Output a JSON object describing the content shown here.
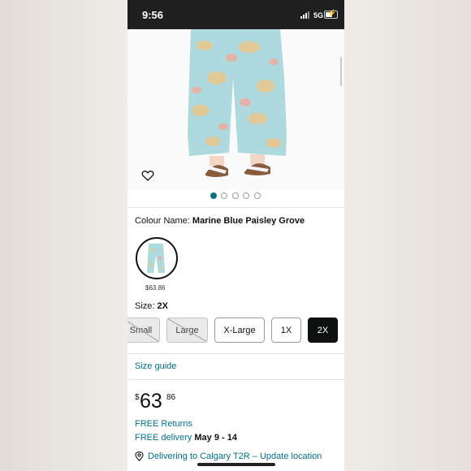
{
  "status_bar": {
    "time": "9:56",
    "network": "5G"
  },
  "colour": {
    "label": "Colour Name:",
    "value": "Marine Blue Paisley Grove",
    "swatch_price": "$63.86"
  },
  "size": {
    "label": "Size:",
    "value": "2X",
    "options": [
      {
        "label": "Small",
        "state": "unavailable"
      },
      {
        "label": "Large",
        "state": "unavailable"
      },
      {
        "label": "X-Large",
        "state": "available"
      },
      {
        "label": "1X",
        "state": "available"
      },
      {
        "label": "2X",
        "state": "selected"
      }
    ]
  },
  "size_guide": "Size guide",
  "price": {
    "currency": "$",
    "whole": "63",
    "fraction": "86"
  },
  "returns": "FREE Returns",
  "delivery": {
    "prefix": "FREE delivery",
    "dates": "May 9 - 14"
  },
  "location": {
    "text": "Delivering to Calgary T2R – Update location"
  },
  "image_carousel": {
    "count": 5,
    "active_index": 0
  },
  "colors": {
    "link": "#007185",
    "pant_base": "#aed9de",
    "selected": "#0f1111"
  }
}
